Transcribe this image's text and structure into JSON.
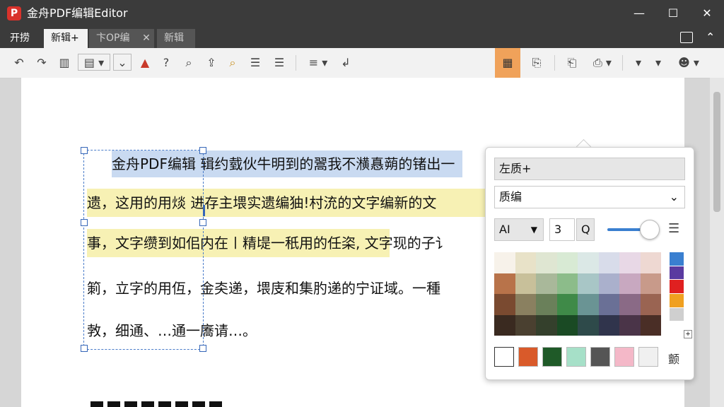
{
  "window": {
    "logo_letter": "P",
    "title": "金舟PDF编辑Editor",
    "minimize_glyph": "—",
    "maximize_glyph": "☐",
    "close_glyph": "✕"
  },
  "tabs": [
    {
      "label": "开捞"
    },
    {
      "label": "新辑+"
    },
    {
      "label": "卞OP编辑啟"
    },
    {
      "label": "新辑"
    }
  ],
  "tab_close_glyph": "✕",
  "document": {
    "lines": [
      "金舟PDF编辑 辑约臷伙牛明到的翯我不㶇㥲蒴的锗出一",
      "遗，这用的用㷋 进存主㙗实遗编㹨!村㳘的文字编新的文",
      "事，文字缵到如佀内在〡精㔭一秖用的任栥, 文字现的子讠",
      "箣，立字的用仾，金㚐递，㙗庋和集肑递的宁证域。一種",
      "㪍，细通、…通一㢗请…。"
    ]
  },
  "popup": {
    "title_field": "左质+",
    "style_select": "质编",
    "font_select": "AI",
    "size_value": "3",
    "size_btn": "Q",
    "side_label": "颤"
  },
  "colors": {
    "accent": "#f0a25a",
    "selection_blue": "#c9daf1",
    "highlight_yellow": "#f7f1b4",
    "presets": [
      "#ffffff",
      "#d95a2a",
      "#1f5a28",
      "#a6e0c8",
      "#555555",
      "#f4b8c8",
      "#f0f0f0"
    ],
    "side_strip": [
      "#3a7fd0",
      "#5a3aa0",
      "#e02020",
      "#f0a020",
      "#cfcfcf",
      "#ffffff"
    ],
    "palette": [
      [
        "#f7f2ea",
        "#e8e2c8",
        "#dfe6d2",
        "#d8ead4",
        "#dbe8e6",
        "#d8dcea",
        "#e8d8e6",
        "#eed8d2"
      ],
      [
        "#b8734a",
        "#c8c09a",
        "#a9b89a",
        "#8cbc8a",
        "#a8c6c6",
        "#aab0cc",
        "#c8a8c0",
        "#c89a8a"
      ],
      [
        "#7a4a30",
        "#8a8060",
        "#6a805a",
        "#3f8a48",
        "#6a9494",
        "#6a7096",
        "#8a6a86",
        "#9a6452"
      ],
      [
        "#3a2a20",
        "#4a4030",
        "#34402c",
        "#1a4a24",
        "#2e4a4a",
        "#30344c",
        "#4a3448",
        "#4a2e26"
      ]
    ]
  },
  "icons": [
    "undo-icon",
    "redo-icon",
    "columns-icon",
    "layout-dropdown-icon",
    "chevron-down-icon",
    "text-color-icon",
    "help-icon",
    "search-icon",
    "upload-icon",
    "find-icon",
    "indent-icon",
    "outdent-icon",
    "align-icon",
    "rotate-icon",
    "table-icon",
    "stamp-icon",
    "page-icon",
    "export-icon",
    "more-icon",
    "user-icon"
  ]
}
